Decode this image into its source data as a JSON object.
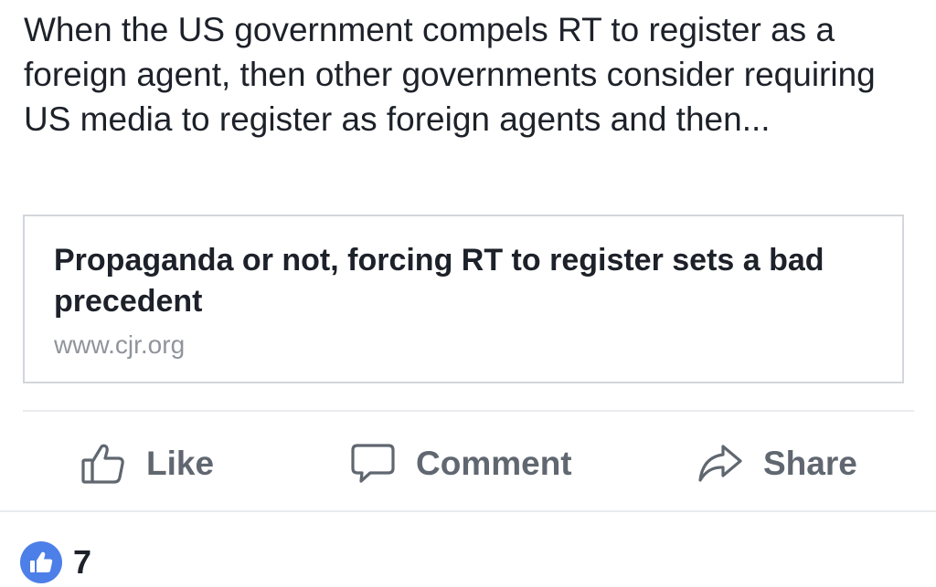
{
  "post": {
    "text": "When the US government compels RT to register as a foreign agent, then other governments consider requiring US media to register as foreign agents and then..."
  },
  "link_preview": {
    "title": "Propaganda or not, forcing RT to register sets a bad precedent",
    "domain": "www.cjr.org"
  },
  "actions": {
    "like_label": "Like",
    "comment_label": "Comment",
    "share_label": "Share"
  },
  "reactions": {
    "icon": "thumbs-up-icon",
    "count": "7"
  },
  "colors": {
    "text": "#1d2129",
    "secondary_text": "#606770",
    "domain_text": "#90949c",
    "border": "#d3d6db",
    "like_blue": "#4d7fe8"
  }
}
